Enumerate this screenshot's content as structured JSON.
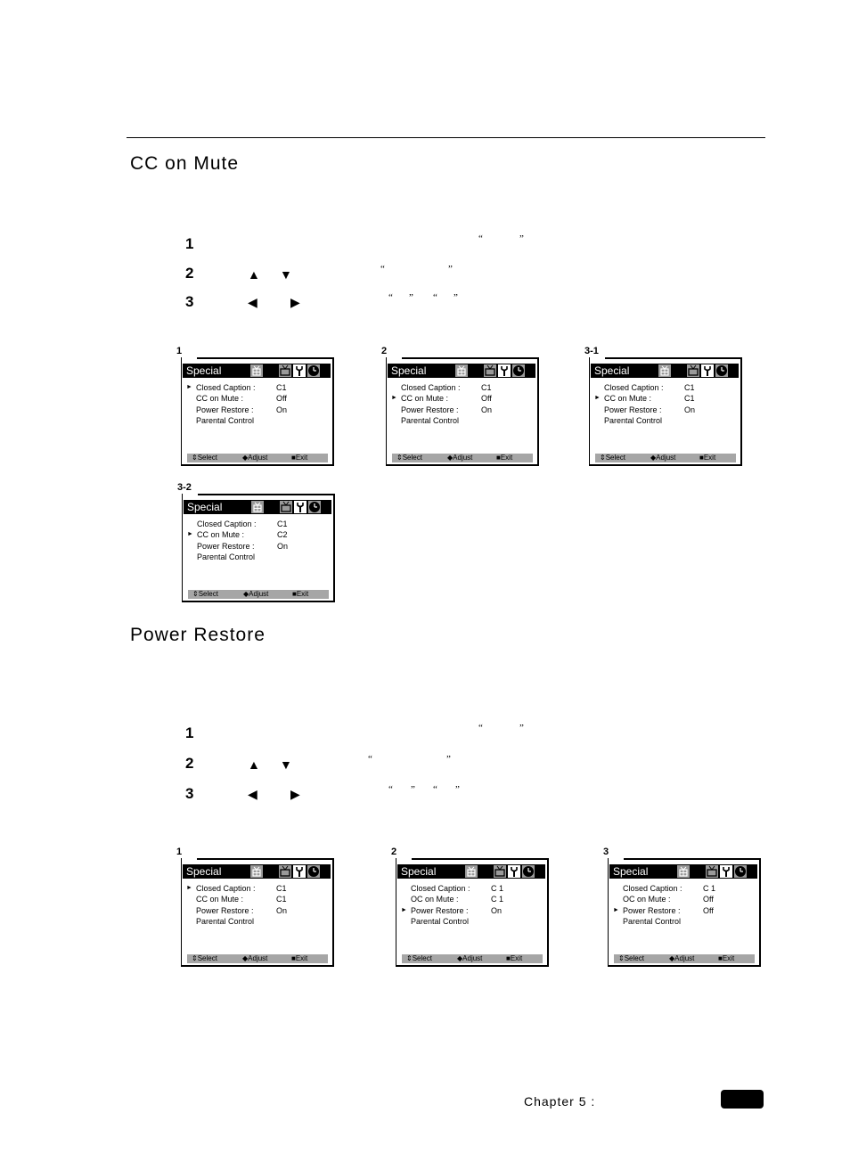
{
  "page": {
    "footer": {
      "chapter_label": "Chapter 5 :"
    }
  },
  "sections": [
    {
      "title": "CC on Mute",
      "steps": [
        {
          "number": "1",
          "quotes": [
            "“",
            "”"
          ]
        },
        {
          "number": "2",
          "arrows": [
            "▲",
            "▼"
          ],
          "quotes": [
            "“",
            "”"
          ]
        },
        {
          "number": "3",
          "arrows": [
            "◀",
            "▶"
          ],
          "quotes": [
            "“",
            "”",
            "“",
            "”"
          ]
        }
      ],
      "screens": [
        {
          "label": "1",
          "title": "Special",
          "selected": 0,
          "rows": [
            {
              "label": "Closed Caption :",
              "value": "C1"
            },
            {
              "label": "CC on Mute :",
              "value": "Off"
            },
            {
              "label": "Power Restore :",
              "value": "On"
            },
            {
              "label": "Parental Control",
              "value": ""
            }
          ]
        },
        {
          "label": "2",
          "title": "Special",
          "selected": 1,
          "rows": [
            {
              "label": "Closed Caption :",
              "value": "C1"
            },
            {
              "label": "CC on Mute :",
              "value": "Off"
            },
            {
              "label": "Power Restore :",
              "value": "On"
            },
            {
              "label": "Parental Control",
              "value": ""
            }
          ]
        },
        {
          "label": "3-1",
          "title": "Special",
          "selected": 1,
          "rows": [
            {
              "label": "Closed Caption :",
              "value": "C1"
            },
            {
              "label": "CC on Mute :",
              "value": "C1"
            },
            {
              "label": "Power Restore :",
              "value": "On"
            },
            {
              "label": "Parental Control",
              "value": ""
            }
          ]
        },
        {
          "label": "3-2",
          "title": "Special",
          "selected": 1,
          "rows": [
            {
              "label": "Closed Caption :",
              "value": "C1"
            },
            {
              "label": "CC on Mute :",
              "value": "C2"
            },
            {
              "label": "Power Restore :",
              "value": "On"
            },
            {
              "label": "Parental Control",
              "value": ""
            }
          ]
        }
      ]
    },
    {
      "title": "Power Restore",
      "steps": [
        {
          "number": "1",
          "quotes": [
            "“",
            "”"
          ]
        },
        {
          "number": "2",
          "arrows": [
            "▲",
            "▼"
          ],
          "quotes": [
            "“",
            "”"
          ]
        },
        {
          "number": "3",
          "arrows": [
            "◀",
            "▶"
          ],
          "quotes": [
            "“",
            "”",
            "“",
            "”"
          ]
        }
      ],
      "screens": [
        {
          "label": "1",
          "title": "Special",
          "selected": 0,
          "rows": [
            {
              "label": "Closed Caption :",
              "value": "C1"
            },
            {
              "label": "CC on Mute :",
              "value": "C1"
            },
            {
              "label": "Power Restore :",
              "value": "On"
            },
            {
              "label": "Parental Control",
              "value": ""
            }
          ]
        },
        {
          "label": "2",
          "title": "Special",
          "selected": 2,
          "rows": [
            {
              "label": "Closed Caption :",
              "value": "C 1"
            },
            {
              "label": "OC on Mute :",
              "value": "C 1"
            },
            {
              "label": "Power Restore :",
              "value": "On"
            },
            {
              "label": "Parental Control",
              "value": ""
            }
          ]
        },
        {
          "label": "3",
          "title": "Special",
          "selected": 2,
          "rows": [
            {
              "label": "Closed Caption :",
              "value": "C 1"
            },
            {
              "label": "OC on Mute :",
              "value": "Off"
            },
            {
              "label": "Power Restore :",
              "value": "Off"
            },
            {
              "label": "Parental Control",
              "value": ""
            }
          ]
        }
      ]
    }
  ],
  "screen_common": {
    "pointer": "►",
    "icons": [
      "gift-icon",
      "tv-icon",
      "wrench-icon",
      "clock-icon"
    ],
    "footer": [
      {
        "glyph": "⇕",
        "label": "Select"
      },
      {
        "glyph": "◆",
        "label": "Adjust"
      },
      {
        "glyph": "■",
        "label": "Exit"
      }
    ]
  }
}
